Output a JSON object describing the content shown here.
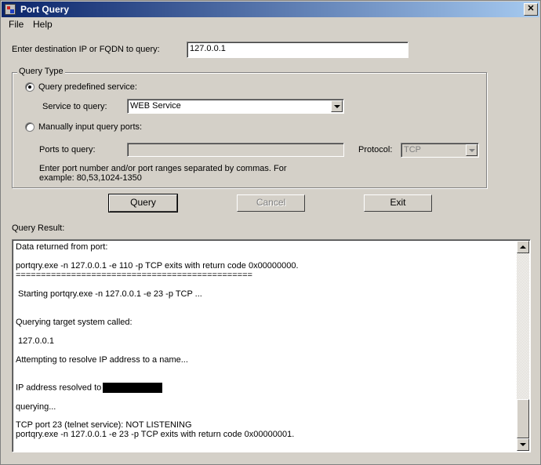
{
  "window": {
    "title": "Port Query",
    "close_glyph": "✕"
  },
  "menu": {
    "items": [
      "File",
      "Help"
    ]
  },
  "destination": {
    "label": "Enter destination IP or FQDN to query:",
    "value": "127.0.0.1"
  },
  "query_type": {
    "group_label": "Query Type",
    "predefined_label": "Query predefined service:",
    "predefined_checked": true,
    "service_label": "Service to query:",
    "service_value": "WEB Service",
    "manual_label": "Manually input query ports:",
    "manual_checked": false,
    "ports_label": "Ports to query:",
    "ports_value": "",
    "protocol_label": "Protocol:",
    "protocol_value": "TCP",
    "hint_line1": "Enter port number and/or port ranges separated by commas. For",
    "hint_line2": "example: 80,53,1024-1350"
  },
  "buttons": {
    "query": "Query",
    "cancel": "Cancel",
    "exit": "Exit"
  },
  "result": {
    "label": "Query Result:",
    "lines": [
      "Data returned from port:",
      "portqry.exe -n 127.0.0.1 -e 110 -p TCP exits with return code 0x00000000.",
      "===============================================",
      " Starting portqry.exe -n 127.0.0.1 -e 23 -p TCP ...",
      "Querying target system called:",
      " 127.0.0.1",
      "Attempting to resolve IP address to a name...",
      "IP address resolved to",
      "querying...",
      "TCP port 23 (telnet service): NOT LISTENING",
      "portqry.exe -n 127.0.0.1 -e 23 -p TCP exits with return code 0x00000001."
    ]
  }
}
